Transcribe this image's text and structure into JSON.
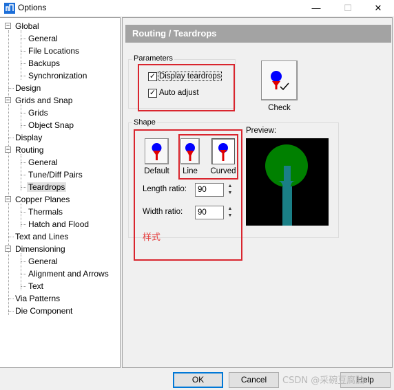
{
  "window": {
    "title": "Options",
    "min_glyph": "—",
    "max_glyph": "☐",
    "close_glyph": "✕"
  },
  "tree": [
    {
      "label": "Global",
      "level": 0,
      "toggle": "−"
    },
    {
      "label": "General",
      "level": 1
    },
    {
      "label": "File Locations",
      "level": 1
    },
    {
      "label": "Backups",
      "level": 1
    },
    {
      "label": "Synchronization",
      "level": 1
    },
    {
      "label": "Design",
      "level": 0
    },
    {
      "label": "Grids and Snap",
      "level": 0,
      "toggle": "−"
    },
    {
      "label": "Grids",
      "level": 1
    },
    {
      "label": "Object Snap",
      "level": 1
    },
    {
      "label": "Display",
      "level": 0
    },
    {
      "label": "Routing",
      "level": 0,
      "toggle": "−"
    },
    {
      "label": "General",
      "level": 1
    },
    {
      "label": "Tune/Diff Pairs",
      "level": 1
    },
    {
      "label": "Teardrops",
      "level": 1,
      "selected": true
    },
    {
      "label": "Copper Planes",
      "level": 0,
      "toggle": "−"
    },
    {
      "label": "Thermals",
      "level": 1
    },
    {
      "label": "Hatch and Flood",
      "level": 1
    },
    {
      "label": "Text and Lines",
      "level": 0
    },
    {
      "label": "Dimensioning",
      "level": 0,
      "toggle": "−"
    },
    {
      "label": "General",
      "level": 1
    },
    {
      "label": "Alignment and Arrows",
      "level": 1
    },
    {
      "label": "Text",
      "level": 1
    },
    {
      "label": "Via Patterns",
      "level": 0
    },
    {
      "label": "Die Component",
      "level": 0
    }
  ],
  "panel": {
    "header": "Routing / Teardrops",
    "parameters": {
      "label": "Parameters",
      "display_teardrops": {
        "label": "Display teardrops",
        "checked": true
      },
      "auto_adjust": {
        "label": "Auto adjust",
        "checked": true
      }
    },
    "check_button": "Check",
    "shape": {
      "label": "Shape",
      "default_label": "Default",
      "line_label": "Line",
      "curved_label": "Curved",
      "selected": "Curved",
      "length_ratio_label": "Length ratio:",
      "length_ratio_value": "90",
      "width_ratio_label": "Width ratio:",
      "width_ratio_value": "90"
    },
    "preview_label": "Preview:",
    "annotation": "样式"
  },
  "buttons": {
    "ok": "OK",
    "cancel": "Cancel",
    "help": "Help"
  },
  "watermark": "CSDN @采碗豆腐脑",
  "colors": {
    "accent": "#0078d7",
    "annotation_red": "#d9252e",
    "pad_blue": "#0000ff",
    "teardrop_red": "#e00000",
    "preview_green": "#008000",
    "preview_teal": "#1a7f86"
  }
}
